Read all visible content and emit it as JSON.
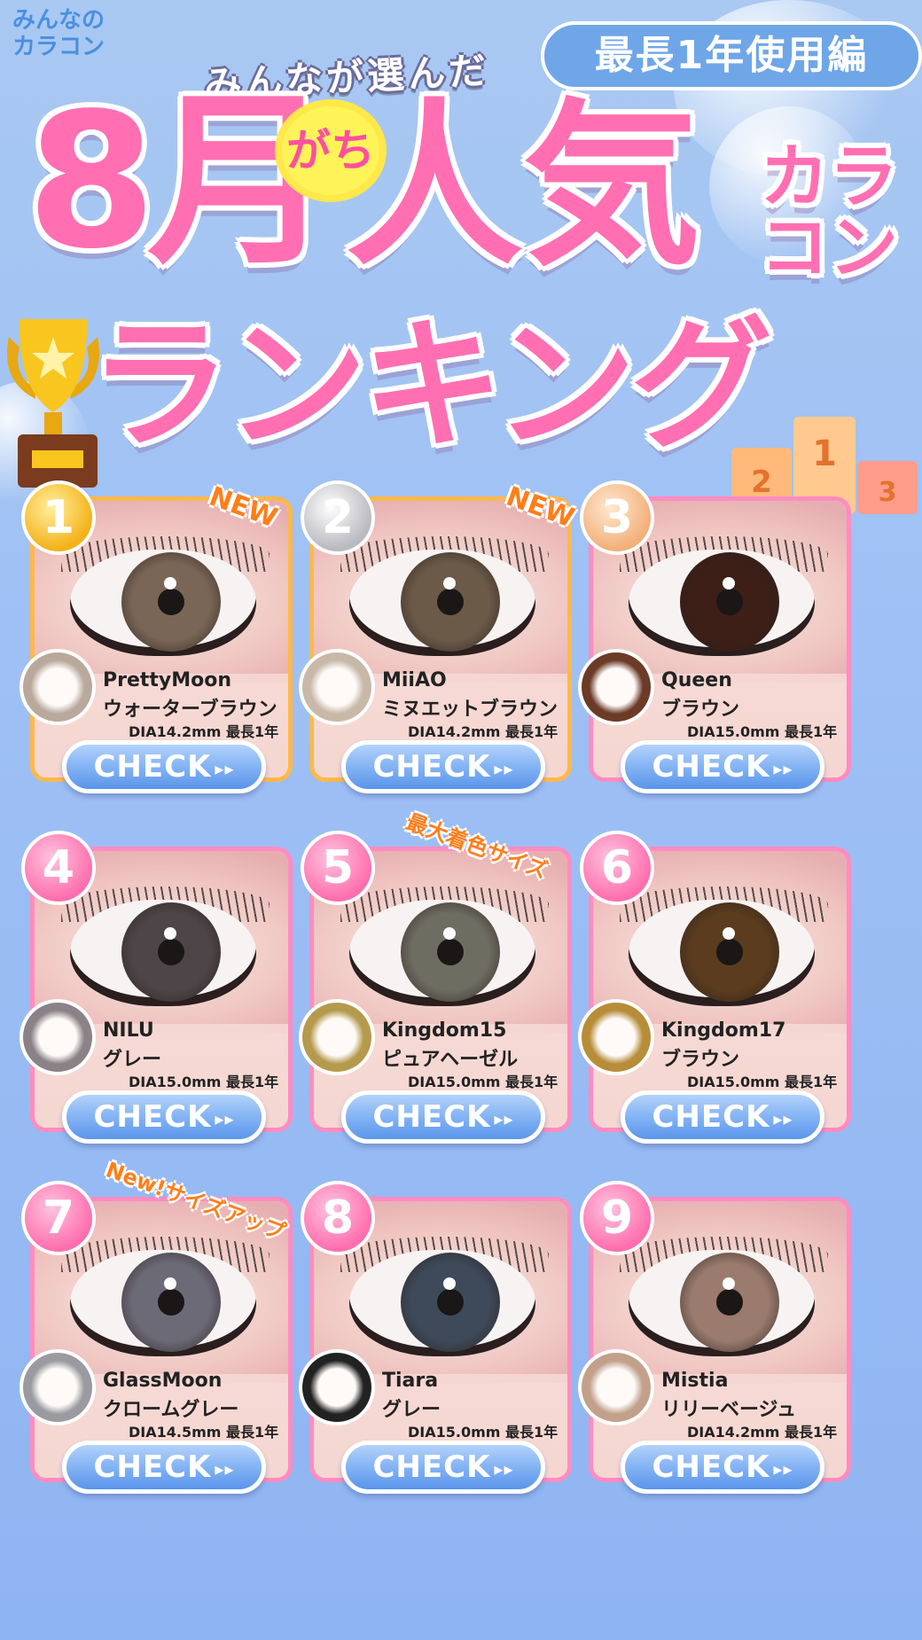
{
  "logo": {
    "line1": "みんなの",
    "line2": "カラコン"
  },
  "edition_badge": "最長1年使用編",
  "subtitle": "みんなが選んだ",
  "title": {
    "month": "8月",
    "gachi": "がち",
    "popular": "人気",
    "category": "カラコン",
    "ranking": "ランキング"
  },
  "podium_numbers": [
    "2",
    "1",
    "3"
  ],
  "colors": {
    "title_pink": "#ff6fb2",
    "button_blue": "#7fb0f3",
    "card_border_pink": "#ff8cc0",
    "card_border_gold": "#ffb84a",
    "tag_orange": "#ff7e1a"
  },
  "products": [
    {
      "rank": "1",
      "name": "PrettyMoon",
      "color": "ウォーターブラウン",
      "spec": "DIA14.2mm 最長1年",
      "tag": "NEW",
      "button": "CHECK",
      "iris": "#7a6656",
      "lens": "#b9a99c"
    },
    {
      "rank": "2",
      "name": "MiiAO",
      "color": "ミヌエットブラウン",
      "spec": "DIA14.2mm 最長1年",
      "tag": "NEW",
      "button": "CHECK",
      "iris": "#6b5a48",
      "lens": "#c8b8a8"
    },
    {
      "rank": "3",
      "name": "Queen",
      "color": "ブラウン",
      "spec": "DIA15.0mm 最長1年",
      "tag": "",
      "button": "CHECK",
      "iris": "#3d1f17",
      "lens": "#6b3b27"
    },
    {
      "rank": "4",
      "name": "NILU",
      "color": "グレー",
      "spec": "DIA15.0mm 最長1年",
      "tag": "",
      "button": "CHECK",
      "iris": "#4d4548",
      "lens": "#8a8286"
    },
    {
      "rank": "5",
      "name": "Kingdom15",
      "color": "ピュアヘーゼル",
      "spec": "DIA15.0mm 最長1年",
      "tag": "最大着色サイズ",
      "button": "CHECK",
      "iris": "#6e6d62",
      "lens": "#b59a4e"
    },
    {
      "rank": "6",
      "name": "Kingdom17",
      "color": "ブラウン",
      "spec": "DIA15.0mm 最長1年",
      "tag": "",
      "button": "CHECK",
      "iris": "#5b3c1e",
      "lens": "#b78d3a"
    },
    {
      "rank": "7",
      "name": "GlassMoon",
      "color": "クロームグレー",
      "spec": "DIA14.5mm 最長1年",
      "tag": "New!サイズアップ",
      "button": "CHECK",
      "iris": "#6d6a78",
      "lens": "#9a9aa0"
    },
    {
      "rank": "8",
      "name": "Tiara",
      "color": "グレー",
      "spec": "DIA15.0mm 最長1年",
      "tag": "",
      "button": "CHECK",
      "iris": "#3e4a5a",
      "lens": "#222222"
    },
    {
      "rank": "9",
      "name": "Mistia",
      "color": "リリーベージュ",
      "spec": "DIA14.2mm 最長1年",
      "tag": "",
      "button": "CHECK",
      "iris": "#9a7b6e",
      "lens": "#c2a08a"
    }
  ]
}
